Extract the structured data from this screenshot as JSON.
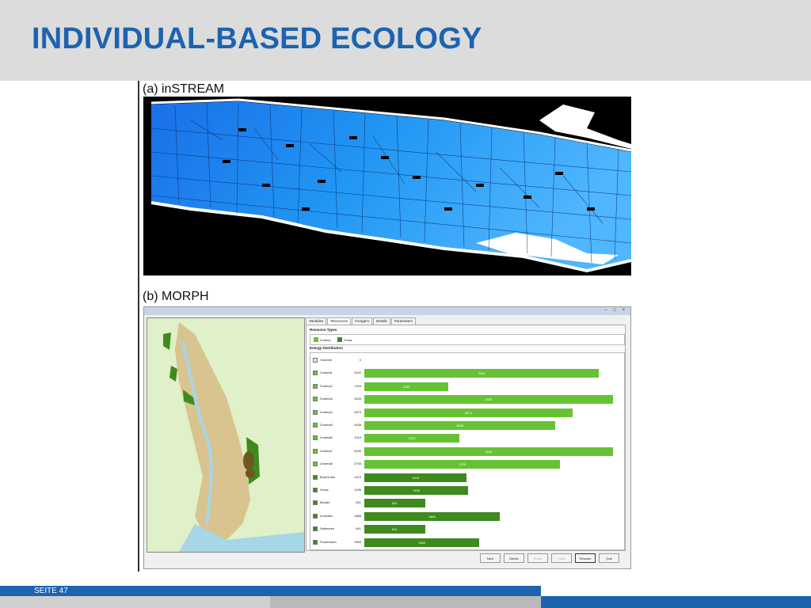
{
  "slide": {
    "title": "INDIVIDUAL-BASED ECOLOGY",
    "footer_page": "SEITE 47"
  },
  "colors": {
    "title_blue": "#1c63b0",
    "header_gray": "#dcdcdc",
    "instream_water": "#1e8ef0",
    "morph_light_bar": "#66c234",
    "morph_dark_bar": "#3f8a1f"
  },
  "figure": {
    "panel_a_label": "(a) inSTREAM",
    "panel_b_label": "(b) MORPH",
    "morph_window": {
      "tabs": [
        "Variables",
        "Resources",
        "Foragers",
        "Details",
        "Parameters"
      ],
      "active_tab": "Resources",
      "resource_types_title": "Resource Types",
      "resource_types": [
        {
          "label": "Zostera",
          "color": "#66c234"
        },
        {
          "label": "Grass",
          "color": "#3f8a1f"
        }
      ],
      "energy_title": "Energy Distribution",
      "energy_rows": [
        {
          "name": "Channel",
          "value": "0",
          "bar": 0,
          "bar_label": "",
          "color": "#cfe3f5"
        },
        {
          "name": "Zostera1",
          "value": "3242",
          "bar": 3242,
          "bar_label": "3242",
          "color": "#66c234"
        },
        {
          "name": "Zostera2",
          "value": "1159",
          "bar": 1159,
          "bar_label": "1159",
          "color": "#66c234"
        },
        {
          "name": "Zostera3",
          "value": "3435",
          "bar": 3435,
          "bar_label": "3435",
          "color": "#66c234"
        },
        {
          "name": "Zostera4",
          "value": "2873",
          "bar": 2873,
          "bar_label": "2873",
          "color": "#66c234"
        },
        {
          "name": "Zostera5",
          "value": "2638",
          "bar": 2638,
          "bar_label": "2638",
          "color": "#66c234"
        },
        {
          "name": "Zostera6",
          "value": "1315",
          "bar": 1315,
          "bar_label": "1315",
          "color": "#66c234"
        },
        {
          "name": "Zostera7",
          "value": "3435",
          "bar": 3435,
          "bar_label": "3435",
          "color": "#66c234"
        },
        {
          "name": "Zostera8",
          "value": "2705",
          "bar": 2705,
          "bar_label": "2705",
          "color": "#66c234"
        },
        {
          "name": "BootGrass",
          "value": "1415",
          "bar": 1415,
          "bar_label": "1415",
          "color": "#3f8a1f"
        },
        {
          "name": "Grass",
          "value": "1436",
          "bar": 1436,
          "bar_label": "1436",
          "color": "#3f8a1f"
        },
        {
          "name": "Beulah",
          "value": "841",
          "bar": 841,
          "bar_label": "841",
          "color": "#3f8a1f"
        },
        {
          "name": "Ironsides",
          "value": "1866",
          "bar": 1866,
          "bar_label": "1866",
          "color": "#3f8a1f"
        },
        {
          "name": "Saltmarsh",
          "value": "841",
          "bar": 841,
          "bar_label": "841",
          "color": "#3f8a1f"
        },
        {
          "name": "Ponderham",
          "value": "1589",
          "bar": 1589,
          "bar_label": "1589",
          "color": "#3f8a1f"
        }
      ],
      "energy_max": 3500,
      "buttons": [
        {
          "label": "Next",
          "enabled": true
        },
        {
          "label": "Delete",
          "enabled": true
        },
        {
          "label": "Prune",
          "enabled": false
        },
        {
          "label": "Hold",
          "enabled": false
        },
        {
          "label": "Resume",
          "enabled": true
        },
        {
          "label": "Quit",
          "enabled": true
        }
      ]
    }
  }
}
